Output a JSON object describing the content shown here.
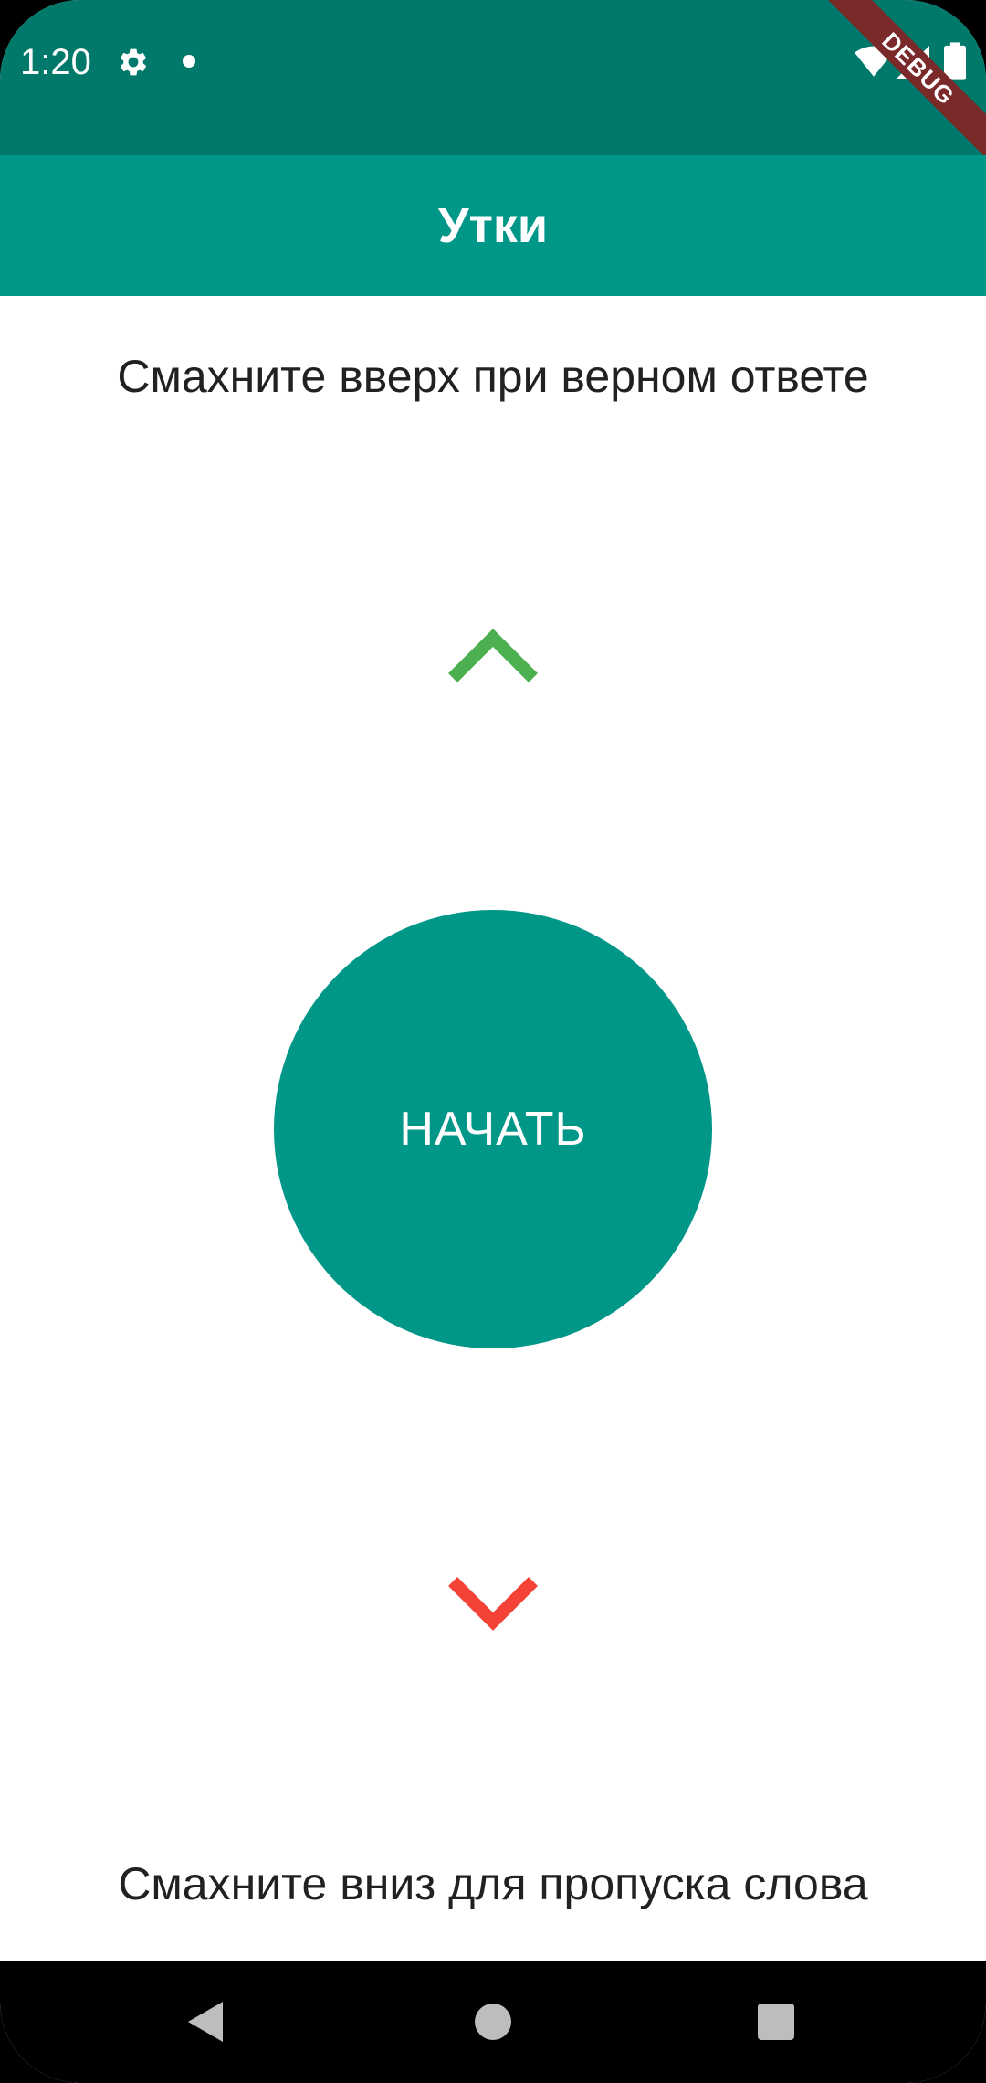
{
  "status_bar": {
    "time": "1:20",
    "debug_label": "DEBUG",
    "icons": [
      "gear-icon",
      "notification-dot-icon",
      "wifi-icon",
      "cell-signal-icon",
      "battery-icon"
    ]
  },
  "app_bar": {
    "title": "Утки"
  },
  "main": {
    "swipe_up_hint": "Смахните вверх при верном ответе",
    "start_button_label": "НАЧАТЬ",
    "swipe_down_hint": "Смахните вниз для пропуска слова"
  },
  "colors": {
    "status_bar": "#00796b",
    "primary": "#009688",
    "up_arrow": "#4caf50",
    "down_arrow": "#f44336",
    "debug_banner": "#7a2a2a"
  },
  "nav_bar": {
    "buttons": [
      "back-icon",
      "home-icon",
      "recents-icon"
    ]
  }
}
